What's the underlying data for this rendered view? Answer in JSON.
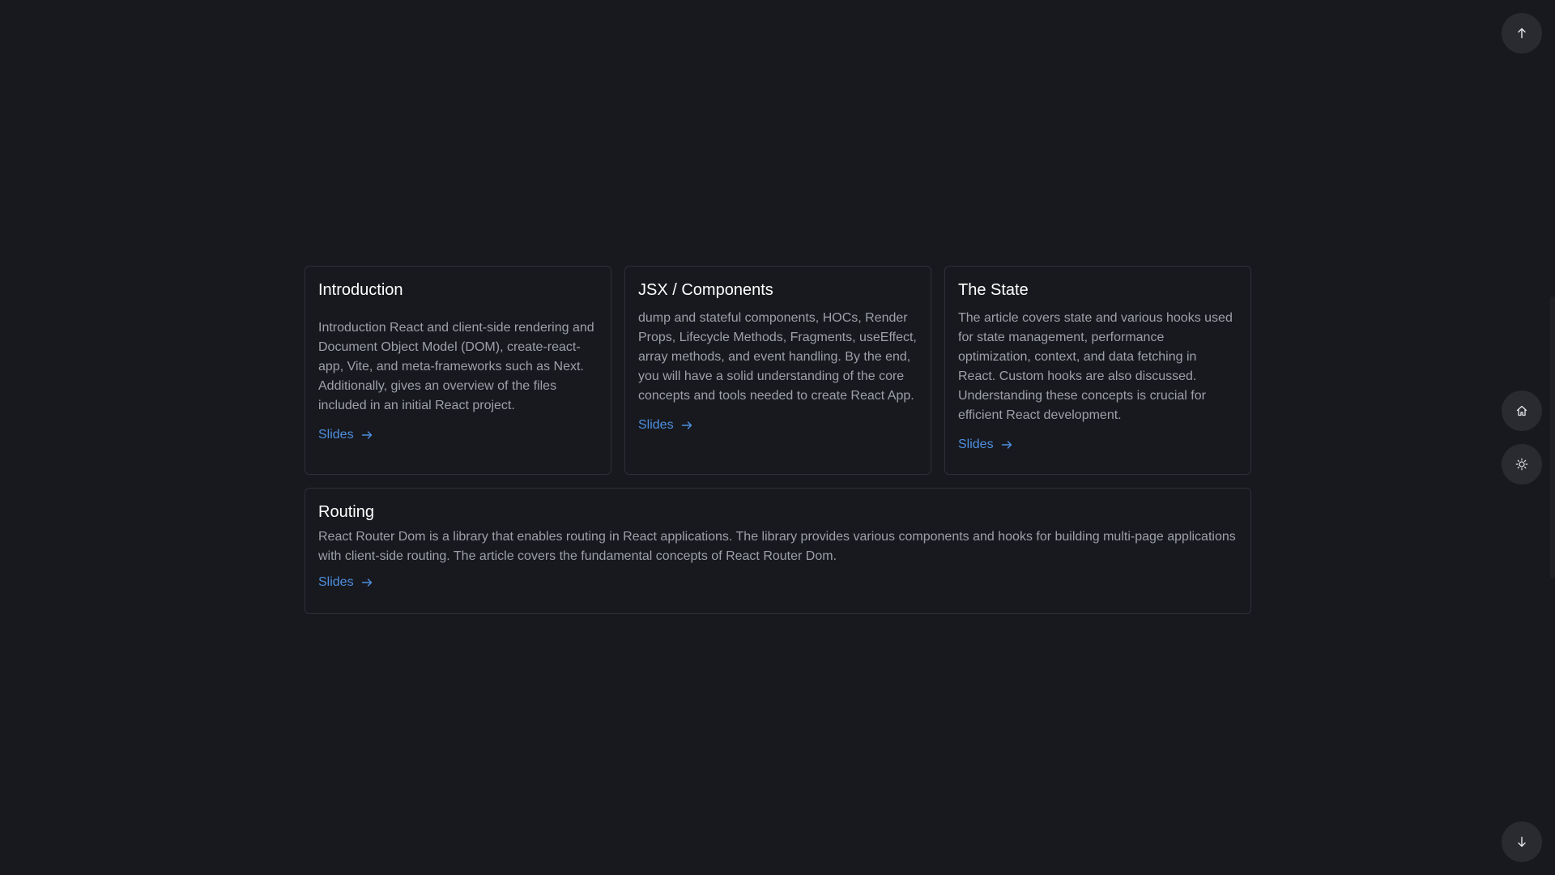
{
  "cards": [
    {
      "title": "Introduction",
      "description": "Introduction React and client-side rendering and Document Object Model (DOM), create-react-app, Vite, and meta-frameworks such as Next. Additionally, gives an overview of the files included in an initial React project.",
      "link_label": "Slides"
    },
    {
      "title": "JSX / Components",
      "description": "dump and stateful components, HOCs, Render Props, Lifecycle Methods, Fragments, useEffect, array methods, and event handling. By the end, you will have a solid understanding of the core concepts and tools needed to create React App.",
      "link_label": "Slides"
    },
    {
      "title": "The State",
      "description": "The article covers state and various hooks used for state management, performance optimization, context, and data fetching in React. Custom hooks are also discussed. Understanding these concepts is crucial for efficient React development.",
      "link_label": "Slides"
    },
    {
      "title": "Routing",
      "description": "React Router Dom is a library that enables routing in React applications. The library provides various components and hooks for building multi-page applications with client-side routing. The article covers the fundamental concepts of React Router Dom.",
      "link_label": "Slides"
    }
  ],
  "controls": {
    "scroll_up_icon": "arrow-up-icon",
    "home_icon": "home-icon",
    "theme_icon": "sun-icon",
    "scroll_down_icon": "arrow-down-icon"
  },
  "colors": {
    "background": "#18191e",
    "card_border": "#2e3038",
    "title": "#ffffff",
    "text": "#9da0a8",
    "link": "#4d8fe0",
    "button_bg": "#2a2b31"
  }
}
